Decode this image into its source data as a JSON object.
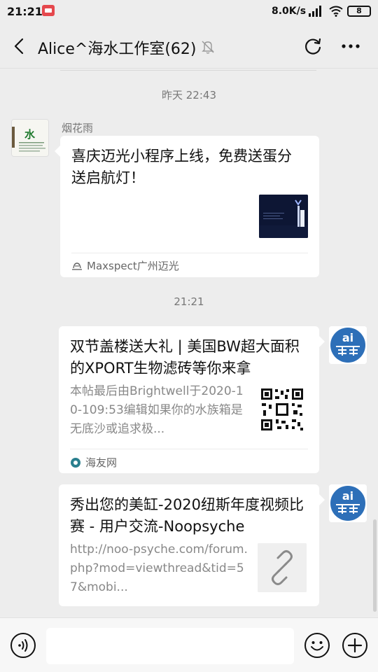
{
  "status_bar": {
    "time": "21:21",
    "net_speed": "8.0K/s",
    "battery": "8"
  },
  "header": {
    "title": "Alice^海水工作室(62)",
    "icons": [
      "back-icon",
      "mute-icon",
      "refresh-icon",
      "more-icon"
    ]
  },
  "messages": [
    {
      "timestamp": "昨天 22:43",
      "sender": "烟花雨",
      "avatar_text": "水",
      "side": "left",
      "card": {
        "title": "喜庆迈光小程序上线，免费送蛋分送启航灯！",
        "source": "Maxspect广州迈光"
      }
    },
    {
      "timestamp": "21:21",
      "side": "right",
      "card": {
        "title": "双节盖楼送大礼 | 美国BW超大面积的XPORT生物滤砖等你来拿",
        "desc": "本帖最后由Brightwell于2020-10-109:53编辑如果你的水族箱是无底沙或追求极...",
        "source": "海友网"
      }
    },
    {
      "side": "right",
      "card": {
        "title": "秀出您的美缸-2020纽斯年度视频比赛 - 用户交流-Noopsyche",
        "desc": "http://noo-psyche.com/forum.php?mod=viewthread&tid=57&mobi..."
      }
    }
  ],
  "colors": {
    "background": "#ededed",
    "card": "#ffffff",
    "avatar_blue": "#2d6fb8"
  }
}
